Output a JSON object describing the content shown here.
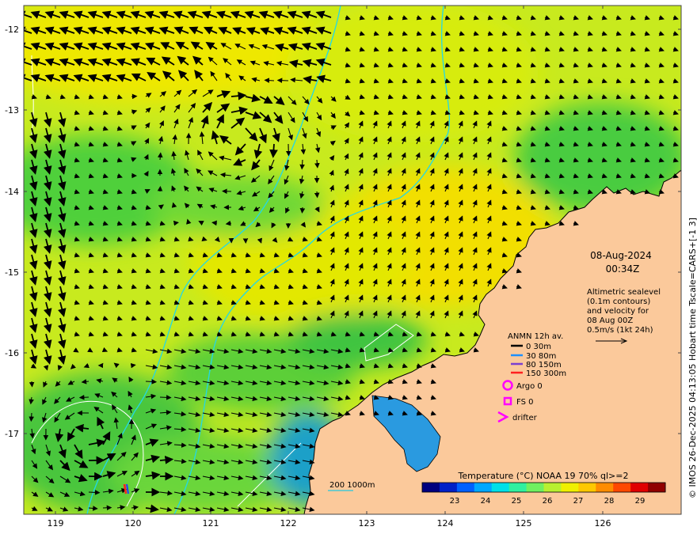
{
  "map": {
    "date": "08-Aug-2024",
    "time": "00:34Z",
    "altimetry_note": [
      "Altimetric sealevel",
      "(0.1m contours)",
      "and velocity for",
      "08 Aug 00Z",
      "0.5m/s (1kt 24h)"
    ],
    "anmn_legend": {
      "title": "ANMN 12h av.",
      "items": [
        {
          "label": "0 30m",
          "color": "#000000"
        },
        {
          "label": "30 80m",
          "color": "#1e90ff"
        },
        {
          "label": "80 150m",
          "color": "#7a3fd1"
        },
        {
          "label": "150 300m",
          "color": "#ff2020"
        }
      ]
    },
    "symbol_legend": [
      {
        "label": "Argo 0",
        "icon": "circle-icon",
        "color": "#ff00ff"
      },
      {
        "label": "FS 0",
        "icon": "square-icon",
        "color": "#ff00ff"
      },
      {
        "label": "drifter",
        "icon": "chevron-icon",
        "color": "#ff00ff"
      }
    ],
    "bathymetry_label": "200  1000m",
    "colorbar": {
      "title": "Temperature (°C) NOAA 19 70% ql>=2",
      "ticks": [
        "23",
        "24",
        "25",
        "26",
        "27",
        "28",
        "29"
      ],
      "colors": [
        "#00007f",
        "#0020c8",
        "#0060ff",
        "#00a8ff",
        "#00e0e8",
        "#30f0a0",
        "#70f060",
        "#b8f030",
        "#f0f000",
        "#ffc800",
        "#ff8c00",
        "#ff4800",
        "#e00000",
        "#900000"
      ]
    },
    "credit": "© IMOS 26-Dec-2025 04:13:05 Hobart time Tscale=CARS+[-1 3]",
    "x_ticks": [
      "119",
      "120",
      "121",
      "122",
      "123",
      "124",
      "125",
      "126"
    ],
    "y_ticks": [
      "-12",
      "-13",
      "-14",
      "-15",
      "-16",
      "-17"
    ],
    "colors": {
      "land": "#fbc99b",
      "warm_sea": "#e8ee00",
      "mid_sea": "#9fe23a",
      "cool_sea": "#2fc84a",
      "cold_sea": "#1ea0e0",
      "isobath": "#22d8e8"
    }
  }
}
